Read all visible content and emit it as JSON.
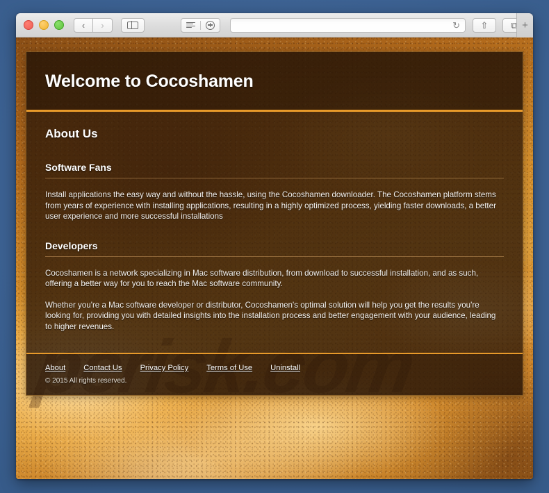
{
  "browser": {
    "traffic_lights": [
      "close",
      "minimize",
      "zoom"
    ],
    "back_label": "‹",
    "forward_label": "›",
    "sidebar_icon": "sidebar-icon",
    "reading_list_icon": "reading-list-icon",
    "add_bookmark_icon": "plus-circle-icon",
    "url_value": "",
    "url_placeholder": "",
    "reload_label": "↻",
    "share_label": "⇧",
    "tabs_label": "⧉",
    "new_tab_label": "+"
  },
  "site": {
    "title": "Welcome to Cocoshamen",
    "watermark": "pcrisk.com",
    "section_title": "About Us",
    "blocks": [
      {
        "heading": "Software Fans",
        "paragraphs": [
          "Install applications the easy way and without the hassle, using the Cocoshamen downloader. The Cocoshamen platform stems from years of experience with installing applications, resulting in a highly optimized process, yielding faster downloads, a better user experience and more successful installations"
        ]
      },
      {
        "heading": "Developers",
        "paragraphs": [
          "Cocoshamen is a network specializing in Mac software distribution, from download to successful installation, and as such, offering a better way for you to reach the Mac software community.",
          "Whether you're a Mac software developer or distributor, Cocoshamen's optimal solution will help you get the results you're looking for, providing you with detailed insights into the installation process and better engagement with your audience, leading to higher revenues."
        ]
      }
    ],
    "footer": {
      "links": [
        {
          "label": "About"
        },
        {
          "label": "Contact Us"
        },
        {
          "label": "Privacy Policy"
        },
        {
          "label": "Terms of Use"
        },
        {
          "label": "Uninstall"
        }
      ],
      "copyright": "© 2015 All rights reserved."
    }
  },
  "colors": {
    "desktop": "#3b6191",
    "accent_orange": "#e89a2a",
    "card_bg": "rgba(48,26,9,0.80)",
    "text_white": "#ffffff"
  }
}
